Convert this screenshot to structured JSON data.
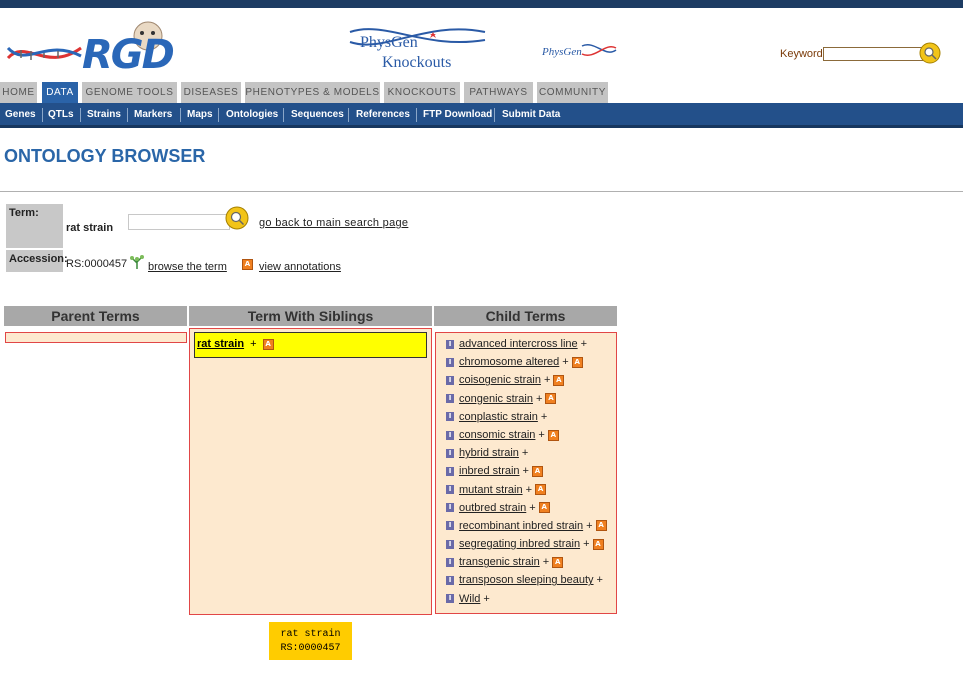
{
  "header": {
    "logo_text": "RGD",
    "physgen_line1": "PhysGen",
    "physgen_line2": "Knockouts",
    "physgen_small": "PhysGen",
    "keyword_label": "Keyword",
    "keyword_value": ""
  },
  "tabs": [
    "HOME",
    "DATA",
    "GENOME TOOLS",
    "DISEASES",
    "PHENOTYPES & MODELS",
    "KNOCKOUTS",
    "PATHWAYS",
    "COMMUNITY"
  ],
  "active_tab": "DATA",
  "subnav": [
    "Genes",
    "QTLs",
    "Strains",
    "Markers",
    "Maps",
    "Ontologies",
    "Sequences",
    "References",
    "FTP Download",
    "Submit Data"
  ],
  "page_title": "ONTOLOGY BROWSER",
  "term": {
    "label": "Term:",
    "value": "rat strain",
    "input_value": "",
    "go_back": "go back to main search page"
  },
  "accession": {
    "label": "Accession:",
    "value": "RS:0000457",
    "browse": "browse the term",
    "annotations": "view annotations"
  },
  "columns": {
    "parent": "Parent Terms",
    "siblings": "Term With Siblings",
    "children": "Child Terms"
  },
  "selected_term": "rat strain",
  "child_terms": [
    {
      "name": "advanced intercross line",
      "annot": false
    },
    {
      "name": "chromosome altered",
      "annot": true
    },
    {
      "name": "coisogenic strain",
      "annot": true
    },
    {
      "name": "congenic strain",
      "annot": true
    },
    {
      "name": "conplastic strain",
      "annot": false
    },
    {
      "name": "consomic strain",
      "annot": true
    },
    {
      "name": "hybrid strain",
      "annot": false
    },
    {
      "name": "inbred strain",
      "annot": true
    },
    {
      "name": "mutant strain",
      "annot": true
    },
    {
      "name": "outbred strain",
      "annot": true
    },
    {
      "name": "recombinant inbred strain",
      "annot": true
    },
    {
      "name": "segregating inbred strain",
      "annot": true
    },
    {
      "name": "transgenic strain",
      "annot": true
    },
    {
      "name": "transposon sleeping beauty",
      "annot": false
    },
    {
      "name": "Wild",
      "annot": false
    }
  ],
  "tooltip": {
    "line1": "rat strain",
    "line2": "RS:0000457"
  },
  "colors": {
    "brand_blue": "#2a66a8",
    "nav_blue": "#23508a",
    "panel_bg": "#fde9cf",
    "panel_border": "#e14646",
    "highlight": "#ffff00"
  }
}
